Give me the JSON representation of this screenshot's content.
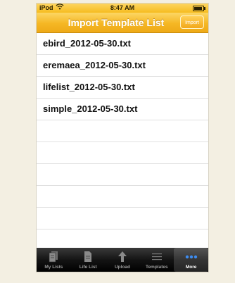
{
  "status_bar": {
    "carrier": "iPod",
    "time": "8:47 AM"
  },
  "nav": {
    "title": "Import Template List",
    "import_button": "Import"
  },
  "files": [
    "ebird_2012-05-30.txt",
    "eremaea_2012-05-30.txt",
    "lifelist_2012-05-30.txt",
    "simple_2012-05-30.txt"
  ],
  "tabs": [
    {
      "label": "My Lists",
      "icon": "document-stack-icon"
    },
    {
      "label": "Life List",
      "icon": "document-icon"
    },
    {
      "label": "Upload",
      "icon": "upload-arrow-icon"
    },
    {
      "label": "Templates",
      "icon": "list-icon"
    },
    {
      "label": "More",
      "icon": "more-dots-icon",
      "selected": true
    }
  ],
  "colors": {
    "nav_yellow": "#f5b724",
    "tab_selected_dots": "#3d8cf0"
  }
}
